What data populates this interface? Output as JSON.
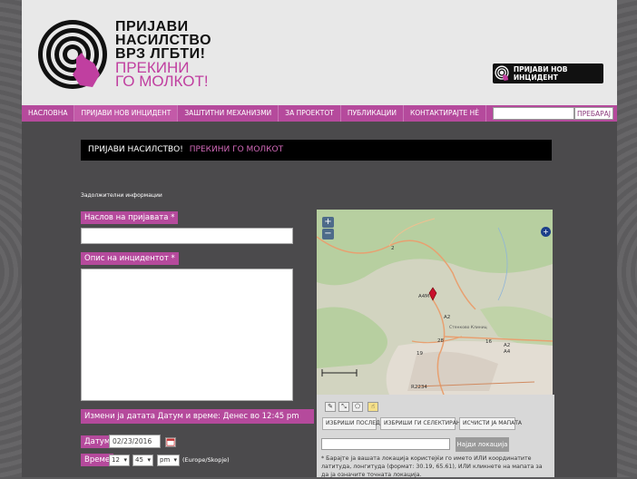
{
  "logo": {
    "line1": "ПРИЈАВИ",
    "line2": "НАСИЛСТВО",
    "line3": "ВРЗ ЛГБТИ!",
    "line4": "ПРЕКИНИ",
    "line5": "ГО МОЛКОТ!"
  },
  "header_button": "ПРИЈАВИ НОВ ИНЦИДЕНТ",
  "nav": {
    "items": [
      "НАСЛОВНА",
      "ПРИЈАВИ НОВ ИНЦИДЕНТ",
      "ЗАШТИТНИ МЕХАНИЗМИ",
      "ЗА ПРОЕКТОТ",
      "ПУБЛИКАЦИИ",
      "КОНТАКТИРАЈТЕ НÈ"
    ],
    "search_button": "ПРЕБАРАЈ"
  },
  "banner": {
    "white": "ПРИЈАВИ НАСИЛСТВО!",
    "pink": "ПРЕКИНИ ГО МОЛКОТ"
  },
  "form": {
    "required_note": "Задолжителни информации",
    "title_label": "Наслов на пријавата *",
    "desc_label": "Опис на инцидентот *",
    "date_change_label": "Измени ја датата Датум и време: Денес во 12:45 pm",
    "date_label": "Датум",
    "date_value": "02/23/2016",
    "time_label": "Време",
    "hour": "12",
    "minute": "45",
    "ampm": "pm",
    "timezone": "(Europe/Skopje)"
  },
  "map": {
    "zoom_in": "+",
    "zoom_out": "−",
    "layers": "+",
    "road_labels": [
      "A4M",
      "A2",
      "A2",
      "A4",
      "28",
      "16",
      "19",
      "R2234",
      "2"
    ],
    "town_label": "Стенково Клиниц"
  },
  "map_tools": {
    "buttons": [
      "ИЗБРИШИ ПОСЛЕДНО",
      "ИЗБРИШИ ГИ СЕЛЕКТИРАНИТЕ",
      "ИСЧИСТИ ЈА МАПАТА"
    ],
    "find_button": "Најди локација",
    "help": "* Барајте ја вашата локација користејќи го името ИЛИ координатите латитуда, лонгитуда (формат: 30.19, 65.61), ИЛИ кликнете на мапата за да ја означите точната локација."
  },
  "colors": {
    "accent": "#b54a9c",
    "header_bg": "#e8e8e8",
    "page_bg": "#4b4a4c",
    "banner_bg": "#000000"
  }
}
